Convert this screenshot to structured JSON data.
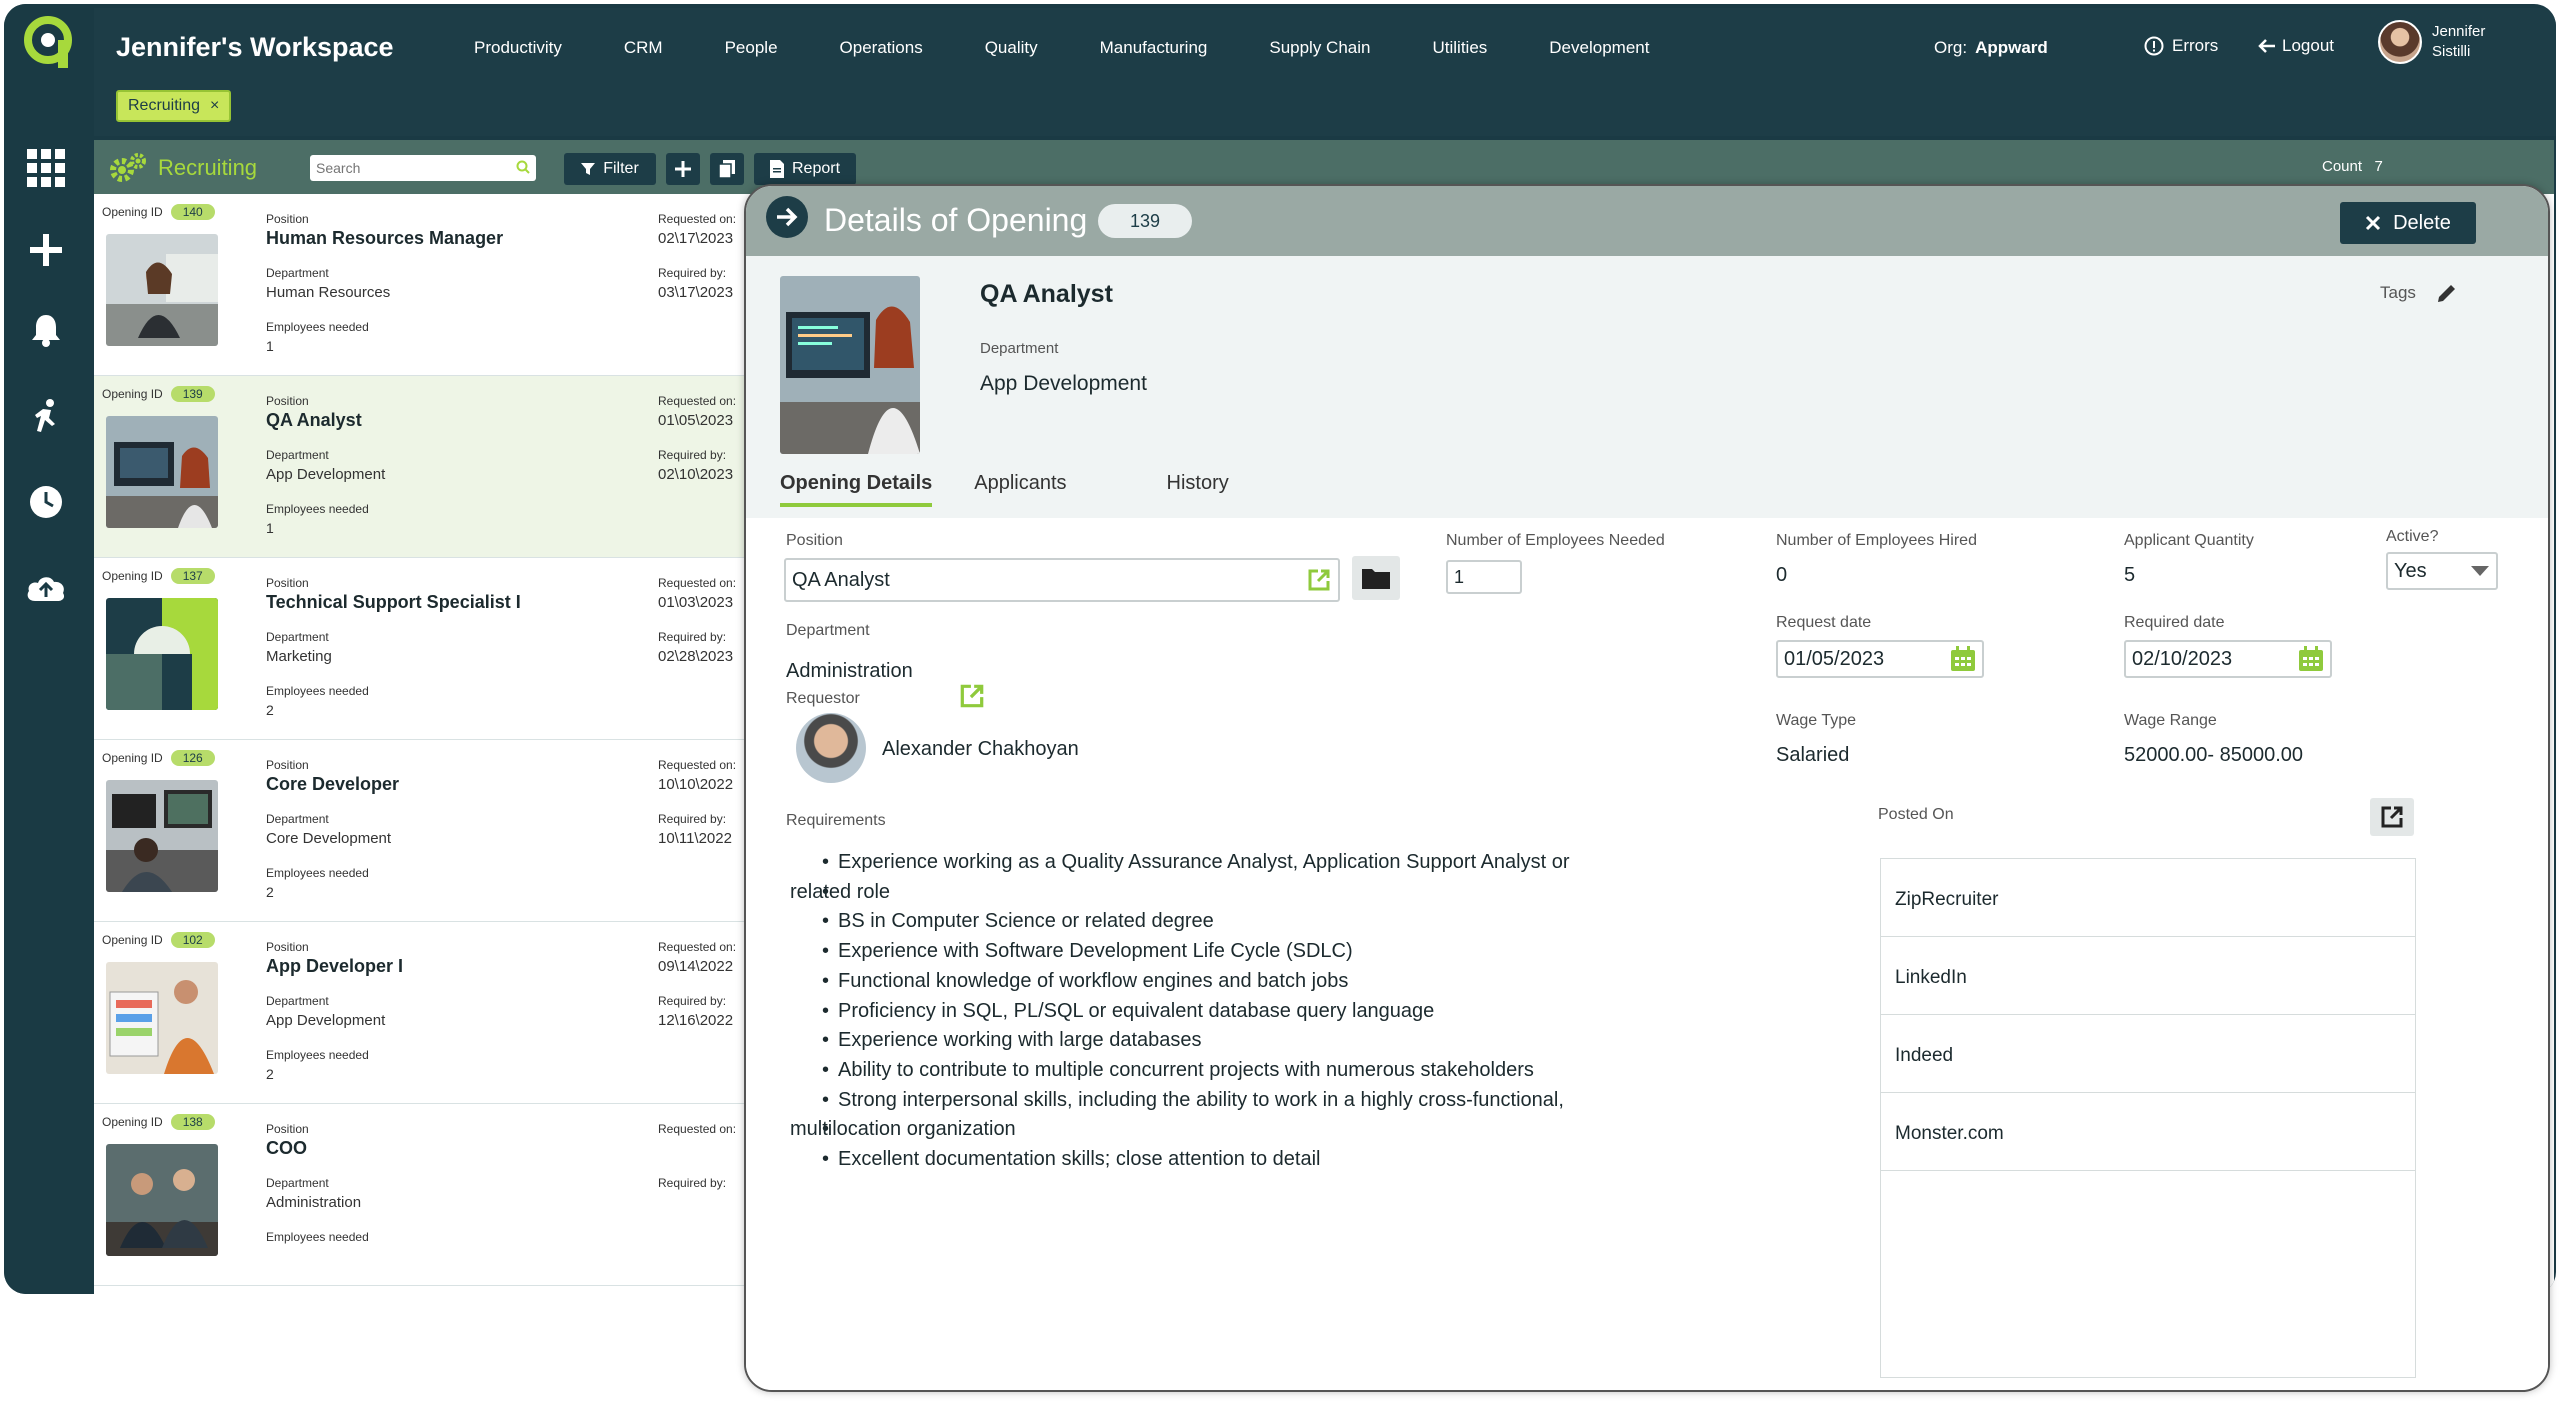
{
  "workspace": {
    "title": "Jennifer's Workspace"
  },
  "nav": [
    "Productivity",
    "CRM",
    "People",
    "Operations",
    "Quality",
    "Manufacturing",
    "Supply Chain",
    "Utilities",
    "Development"
  ],
  "org": {
    "label": "Org:",
    "value": "Appward"
  },
  "errors_label": "Errors",
  "logout_label": "Logout",
  "user": {
    "first": "Jennifer",
    "last": "Sistilli"
  },
  "chip": {
    "label": "Recruiting",
    "close": "×"
  },
  "toolbar": {
    "title": "Recruiting",
    "search_placeholder": "Search",
    "filter_label": "Filter",
    "report_label": "Report",
    "count_label": "Count",
    "count_value": "7"
  },
  "list_labels": {
    "opening_id": "Opening ID",
    "position": "Position",
    "department": "Department",
    "employees_needed": "Employees needed",
    "requested_on": "Requested on:",
    "required_by": "Required by:"
  },
  "openings": [
    {
      "id": "140",
      "position": "Human Resources Manager",
      "department": "Human Resources",
      "employees": "1",
      "requested": "02\\17\\2023",
      "required": "03\\17\\2023"
    },
    {
      "id": "139",
      "position": "QA Analyst",
      "department": "App Development",
      "employees": "1",
      "requested": "01\\05\\2023",
      "required": "02\\10\\2023"
    },
    {
      "id": "137",
      "position": "Technical Support Specialist I",
      "department": "Marketing",
      "employees": "2",
      "requested": "01\\03\\2023",
      "required": "02\\28\\2023"
    },
    {
      "id": "126",
      "position": "Core Developer",
      "department": "Core Development",
      "employees": "2",
      "requested": "10\\10\\2022",
      "required": "10\\11\\2022"
    },
    {
      "id": "102",
      "position": "App Developer I",
      "department": "App Development",
      "employees": "2",
      "requested": "09\\14\\2022",
      "required": "12\\16\\2022"
    },
    {
      "id": "138",
      "position": "COO",
      "department": "Administration",
      "employees": "",
      "requested": "",
      "required": ""
    }
  ],
  "details": {
    "header_title": "Details of Opening",
    "header_id": "139",
    "delete_label": "Delete",
    "position": "QA Analyst",
    "department_label": "Department",
    "department": "App Development",
    "tags_label": "Tags",
    "tabs": [
      "Opening Details",
      "Applicants",
      "History"
    ],
    "fields": {
      "position_label": "Position",
      "position_value": "QA Analyst",
      "employees_needed_label": "Number of Employees Needed",
      "employees_needed_value": "1",
      "employees_hired_label": "Number of Employees Hired",
      "employees_hired_value": "0",
      "applicant_qty_label": "Applicant Quantity",
      "applicant_qty_value": "5",
      "active_label": "Active?",
      "active_value": "Yes",
      "department_label": "Department",
      "department_value": "Administration",
      "request_date_label": "Request date",
      "request_date_value": "01/05/2023",
      "required_date_label": "Required date",
      "required_date_value": "02/10/2023",
      "requestor_label": "Requestor",
      "requestor_name": "Alexander Chakhoyan",
      "wage_type_label": "Wage Type",
      "wage_type_value": "Salaried",
      "wage_range_label": "Wage Range",
      "wage_range_value": "52000.00- 85000.00",
      "requirements_label": "Requirements",
      "posted_on_label": "Posted On"
    },
    "requirements": [
      "Experience working as a Quality Assurance Analyst, Application Support Analyst or",
      "related role",
      "BS in Computer Science or related degree",
      "Experience with Software Development Life Cycle (SDLC)",
      "Functional knowledge of workflow engines and batch jobs",
      "Proficiency in SQL, PL/SQL or equivalent database query language",
      "Experience working with large databases",
      "Ability to contribute to multiple concurrent projects with numerous stakeholders",
      "Strong interpersonal skills, including the ability to work in a highly cross-functional,",
      "multilocation organization",
      "Excellent documentation skills; close attention to detail"
    ],
    "posted_on": [
      "ZipRecruiter",
      "LinkedIn",
      "Indeed",
      "Monster.com"
    ]
  },
  "colors": {
    "dark": "#1d3d47",
    "accent": "#a7d93c",
    "header": "#4c6e66"
  }
}
